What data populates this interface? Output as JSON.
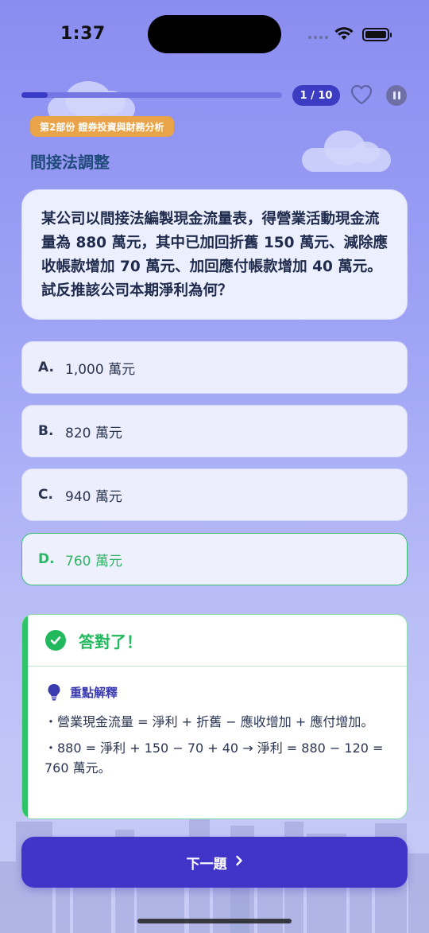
{
  "status_bar": {
    "time": "1:37"
  },
  "header": {
    "progress": 0.1,
    "counter": "1 / 10",
    "section_badge": "第2部份 證券投資與財務分析",
    "topic_title": "間接法調整"
  },
  "question": {
    "text": "某公司以間接法編製現金流量表，得營業活動現金流量為 880 萬元，其中已加回折舊 150 萬元、減除應收帳款增加 70 萬元、加回應付帳款增加 40 萬元。試反推該公司本期淨利為何？"
  },
  "options": [
    {
      "letter": "A.",
      "text": "1,000 萬元"
    },
    {
      "letter": "B.",
      "text": "820 萬元"
    },
    {
      "letter": "C.",
      "text": "940 萬元"
    },
    {
      "letter": "D.",
      "text": "760 萬元"
    }
  ],
  "feedback": {
    "title": "答對了！",
    "explain_title": "重點解釋",
    "lines": [
      "・營業現金流量 = 淨利 + 折舊 − 應收增加 + 應付增加。",
      "・880 = 淨利 + 150 − 70 + 40 → 淨利 = 880 − 120 = 760 萬元。"
    ]
  },
  "next_button": {
    "label": "下一題",
    "icon": "chevron-right-icon"
  },
  "colors": {
    "accent": "#4134c9",
    "correct": "#22b95e",
    "badge": "#e9a44a"
  }
}
